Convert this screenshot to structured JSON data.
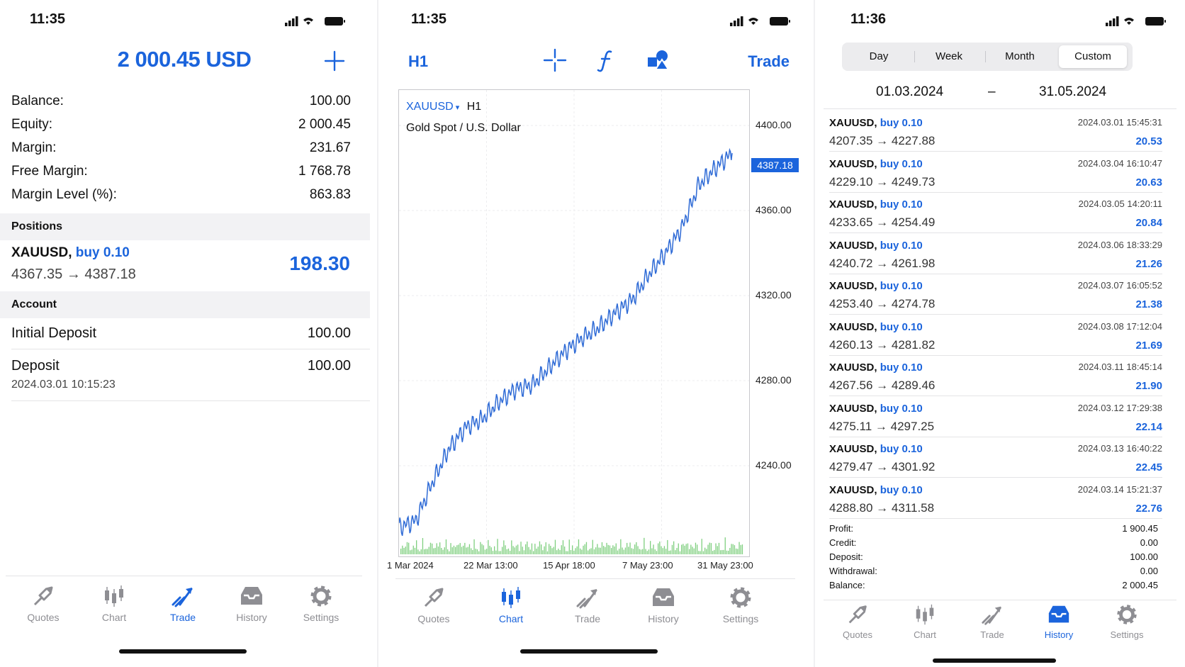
{
  "trade_screen": {
    "status_time": "11:35",
    "account_total": "2 000.45 USD",
    "summary": [
      {
        "label": "Balance:",
        "value": "100.00"
      },
      {
        "label": "Equity:",
        "value": "2 000.45"
      },
      {
        "label": "Margin:",
        "value": "231.67"
      },
      {
        "label": "Free Margin:",
        "value": "1 768.78"
      },
      {
        "label": "Margin Level (%):",
        "value": "863.83"
      }
    ],
    "positions_header": "Positions",
    "position": {
      "symbol": "XAUUSD,",
      "side": "buy 0.10",
      "prices": "4367.35 → 4387.18",
      "profit": "198.30"
    },
    "account_header": "Account",
    "initial_deposit": {
      "label": "Initial Deposit",
      "value": "100.00"
    },
    "deposit": {
      "label": "Deposit",
      "value": "100.00",
      "date": "2024.03.01 10:15:23"
    }
  },
  "chart_screen": {
    "status_time": "11:35",
    "timeframe": "H1",
    "trade_label": "Trade",
    "symbol": "XAUUSD",
    "symbol_tf": "H1",
    "description": "Gold Spot / U.S. Dollar",
    "y_ticks": [
      "4400.00",
      "4360.00",
      "4320.00",
      "4280.00",
      "4240.00"
    ],
    "current_price": "4387.18",
    "x_ticks": [
      "1 Mar 2024",
      "22 Mar 13:00",
      "15 Apr 18:00",
      "7 May 23:00",
      "31 May 23:00"
    ]
  },
  "chart_data": {
    "type": "line",
    "series": [
      {
        "name": "XAUUSD",
        "values": [
          4211,
          4214,
          4232,
          4248,
          4258,
          4262,
          4270,
          4276,
          4278,
          4286,
          4294,
          4300,
          4305,
          4312,
          4318,
          4330,
          4340,
          4352,
          4372,
          4380,
          4387
        ]
      }
    ],
    "ylim": [
      4210,
      4410
    ],
    "y_ticks": [
      4240,
      4280,
      4320,
      4360,
      4400
    ],
    "x_tick_labels": [
      "1 Mar 2024",
      "22 Mar 13:00",
      "15 Apr 18:00",
      "7 May 23:00",
      "31 May 23:00"
    ],
    "grid": true,
    "line_color": "#2f6bd6",
    "volume_color": "#7fcf7f"
  },
  "history_screen": {
    "status_time": "11:36",
    "segments": [
      "Day",
      "Week",
      "Month",
      "Custom"
    ],
    "range_from": "01.03.2024",
    "range_sep": "–",
    "range_to": "31.05.2024",
    "deals": [
      {
        "symbol": "XAUUSD,",
        "side": "buy 0.10",
        "prices": "4207.35 → 4227.88",
        "time": "2024.03.01 15:45:31",
        "profit": "20.53"
      },
      {
        "symbol": "XAUUSD,",
        "side": "buy 0.10",
        "prices": "4229.10 → 4249.73",
        "time": "2024.03.04 16:10:47",
        "profit": "20.63"
      },
      {
        "symbol": "XAUUSD,",
        "side": "buy 0.10",
        "prices": "4233.65 → 4254.49",
        "time": "2024.03.05 14:20:11",
        "profit": "20.84"
      },
      {
        "symbol": "XAUUSD,",
        "side": "buy 0.10",
        "prices": "4240.72 → 4261.98",
        "time": "2024.03.06 18:33:29",
        "profit": "21.26"
      },
      {
        "symbol": "XAUUSD,",
        "side": "buy 0.10",
        "prices": "4253.40 → 4274.78",
        "time": "2024.03.07 16:05:52",
        "profit": "21.38"
      },
      {
        "symbol": "XAUUSD,",
        "side": "buy 0.10",
        "prices": "4260.13 → 4281.82",
        "time": "2024.03.08 17:12:04",
        "profit": "21.69"
      },
      {
        "symbol": "XAUUSD,",
        "side": "buy 0.10",
        "prices": "4267.56 → 4289.46",
        "time": "2024.03.11 18:45:14",
        "profit": "21.90"
      },
      {
        "symbol": "XAUUSD,",
        "side": "buy 0.10",
        "prices": "4275.11 → 4297.25",
        "time": "2024.03.12 17:29:38",
        "profit": "22.14"
      },
      {
        "symbol": "XAUUSD,",
        "side": "buy 0.10",
        "prices": "4279.47 → 4301.92",
        "time": "2024.03.13 16:40:22",
        "profit": "22.45"
      },
      {
        "symbol": "XAUUSD,",
        "side": "buy 0.10",
        "prices": "4288.80 → 4311.58",
        "time": "2024.03.14 15:21:37",
        "profit": "22.76"
      }
    ],
    "totals": [
      {
        "label": "Profit:",
        "value": "1 900.45"
      },
      {
        "label": "Credit:",
        "value": "0.00"
      },
      {
        "label": "Deposit:",
        "value": "100.00"
      },
      {
        "label": "Withdrawal:",
        "value": "0.00"
      },
      {
        "label": "Balance:",
        "value": "2 000.45"
      }
    ]
  },
  "tabs": [
    "Quotes",
    "Chart",
    "Trade",
    "History",
    "Settings"
  ],
  "icons": {
    "quotes": "quotes-icon",
    "chart": "chart-icon",
    "trade": "trade-icon",
    "history": "history-icon",
    "settings": "gear-icon"
  },
  "colors": {
    "accent": "#1b64dc",
    "inactive": "#8e8e93"
  }
}
